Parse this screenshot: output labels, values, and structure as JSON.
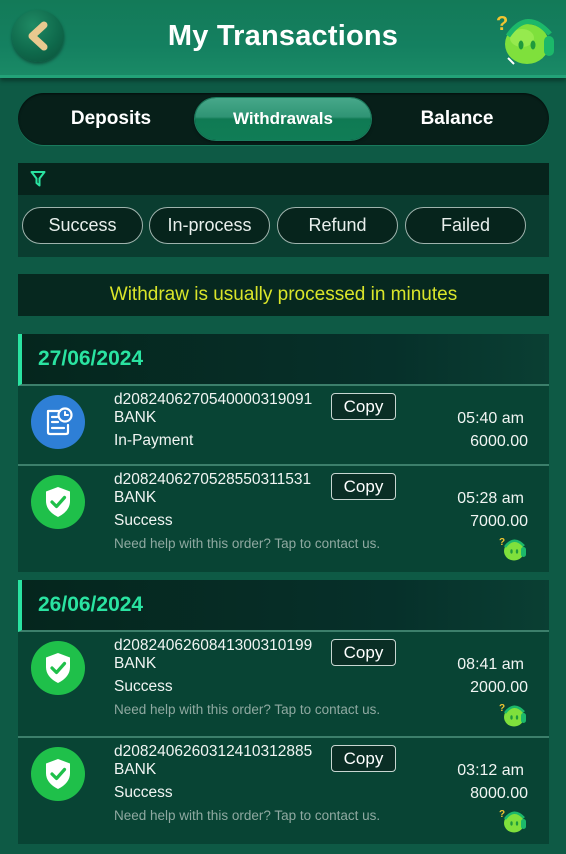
{
  "header": {
    "title": "My Transactions",
    "back_icon": "chevron-left-icon",
    "support_icon": "customer-support-mascot-icon"
  },
  "tabs": [
    {
      "label": "Deposits",
      "active": false
    },
    {
      "label": "Withdrawals",
      "active": true
    },
    {
      "label": "Balance",
      "active": false
    }
  ],
  "filter": {
    "icon": "filter-icon",
    "chips": [
      "Success",
      "In-process",
      "Refund",
      "Failed"
    ]
  },
  "notice": "Withdraw is usually processed in minutes",
  "groups": [
    {
      "date": "27/06/2024",
      "transactions": [
        {
          "id": "d2082406270540000319091",
          "method": "BANK",
          "status": "In-Payment",
          "time": "05:40 am",
          "amount": "6000.00",
          "icon": "pending-receipt-icon",
          "copy_label": "Copy"
        },
        {
          "id": "d2082406270528550311531",
          "method": "BANK",
          "status": "Success",
          "time": "05:28 am",
          "amount": "7000.00",
          "icon": "success-shield-icon",
          "copy_label": "Copy",
          "help_text": "Need help with this order? Tap to contact us."
        }
      ]
    },
    {
      "date": "26/06/2024",
      "transactions": [
        {
          "id": "d2082406260841300310199",
          "method": "BANK",
          "status": "Success",
          "time": "08:41 am",
          "amount": "2000.00",
          "icon": "success-shield-icon",
          "copy_label": "Copy",
          "help_text": "Need help with this order? Tap to contact us."
        },
        {
          "id": "d2082406260312410312885",
          "method": "BANK",
          "status": "Success",
          "time": "03:12 am",
          "amount": "8000.00",
          "icon": "success-shield-icon",
          "copy_label": "Copy",
          "help_text": "Need help with this order? Tap to contact us."
        }
      ]
    }
  ],
  "colors": {
    "background": "#0e5a45",
    "header": "#148060",
    "accent_date": "#2ae3a1",
    "notice_text": "#d9e52a",
    "success_icon": "#1fc04a",
    "pending_icon": "#2e7fd6"
  }
}
